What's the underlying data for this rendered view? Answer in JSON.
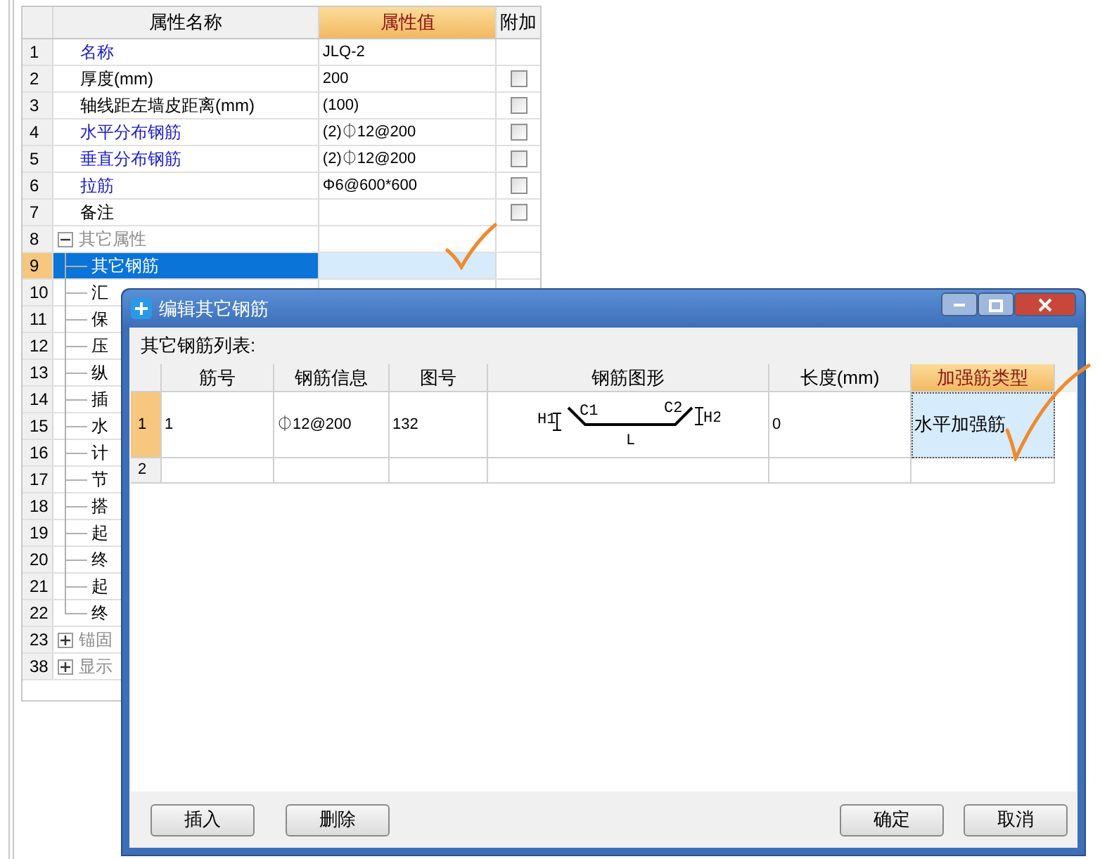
{
  "property_table": {
    "columns": [
      "属性名称",
      "属性值",
      "附加"
    ],
    "rows": [
      {
        "number": "1",
        "name": "名称",
        "kind": "linked",
        "value": "JLQ-2",
        "selected": false
      },
      {
        "number": "2",
        "name": "厚度(mm)",
        "kind": "plain",
        "value": "200",
        "checkbox": {
          "checked": false
        },
        "selected": false
      },
      {
        "number": "3",
        "name": "轴线距左墙皮距离(mm)",
        "kind": "plain",
        "value": "(100)",
        "checkbox": {
          "checked": false
        },
        "selected": false
      },
      {
        "number": "4",
        "name": "水平分布钢筋",
        "kind": "linked",
        "value": "(2)⏀12@200",
        "checkbox": {
          "checked": false
        },
        "selected": false
      },
      {
        "number": "5",
        "name": "垂直分布钢筋",
        "kind": "linked",
        "value": "(2)⏀12@200",
        "checkbox": {
          "checked": false
        },
        "selected": false
      },
      {
        "number": "6",
        "name": "拉筋",
        "kind": "linked",
        "value": "Φ6@600*600",
        "checkbox": {
          "checked": false
        },
        "selected": false
      },
      {
        "number": "7",
        "name": "备注",
        "kind": "plain",
        "value": "",
        "checkbox": {
          "checked": false
        },
        "selected": false
      },
      {
        "number": "8",
        "name": "其它属性",
        "kind": "group",
        "expanded": true,
        "selected": false,
        "children": [
          {
            "number": "9",
            "name": "其它钢筋",
            "kind": "child",
            "selected": true
          },
          {
            "number": "10",
            "name": "汇",
            "kind": "child",
            "selected": false
          },
          {
            "number": "11",
            "name": "保",
            "kind": "child",
            "selected": false
          },
          {
            "number": "12",
            "name": "压",
            "kind": "child",
            "selected": false
          },
          {
            "number": "13",
            "name": "纵",
            "kind": "child",
            "selected": false
          },
          {
            "number": "14",
            "name": "插",
            "kind": "child",
            "selected": false
          },
          {
            "number": "15",
            "name": "水",
            "kind": "child",
            "selected": false
          },
          {
            "number": "16",
            "name": "计",
            "kind": "child",
            "selected": false
          },
          {
            "number": "17",
            "name": "节",
            "kind": "child",
            "selected": false
          },
          {
            "number": "18",
            "name": "搭",
            "kind": "child",
            "selected": false
          },
          {
            "number": "19",
            "name": "起",
            "kind": "child",
            "selected": false
          },
          {
            "number": "20",
            "name": "终",
            "kind": "child",
            "selected": false
          },
          {
            "number": "21",
            "name": "起",
            "kind": "child",
            "selected": false
          },
          {
            "number": "22",
            "name": "终",
            "kind": "child",
            "selected": false
          }
        ]
      },
      {
        "number": "23",
        "name": "锚固",
        "kind": "group",
        "expanded": false,
        "selected": false
      },
      {
        "number": "38",
        "name": "显示",
        "kind": "group",
        "expanded": false,
        "selected": false
      }
    ]
  },
  "dialog": {
    "title": "编辑其它钢筋",
    "list_label": "其它钢筋列表:",
    "columns": [
      "筋号",
      "钢筋信息",
      "图号",
      "钢筋图形",
      "长度(mm)",
      "加强筋类型"
    ],
    "rows": [
      {
        "number": "1",
        "bar_no": "1",
        "info": "⏀12@200",
        "shape_no": "132",
        "shape_labels": [
          "H1",
          "C1",
          "C2",
          "H2",
          "L"
        ],
        "length": "0",
        "type": "水平加强筋",
        "selected": true
      },
      {
        "number": "2",
        "bar_no": "",
        "info": "",
        "shape_no": "",
        "length": "",
        "type": "",
        "selected": false
      }
    ],
    "buttons_left": [
      "插入",
      "删除"
    ],
    "buttons_right": [
      "确定",
      "取消"
    ]
  }
}
